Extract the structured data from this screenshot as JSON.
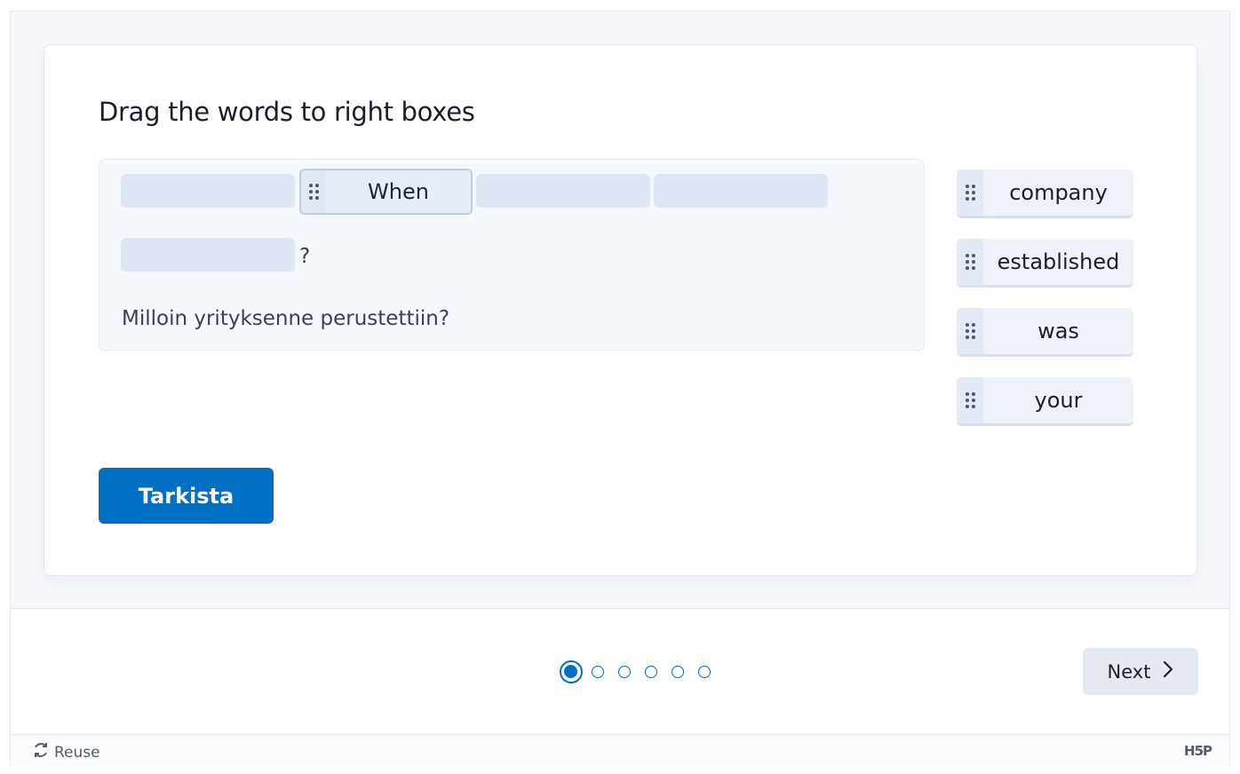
{
  "task": {
    "title": "Drag the words to right boxes",
    "placed_word": "When",
    "question_mark": "?",
    "translation": "Milloin yrityksenne perustettiin?",
    "word_bank": [
      "company",
      "established",
      "was",
      "your"
    ],
    "check_label": "Tarkista"
  },
  "navigation": {
    "total_slides": 6,
    "current_slide": 1,
    "next_label": "Next"
  },
  "footer": {
    "reuse_label": "Reuse",
    "logo_text": "H5P"
  },
  "colors": {
    "primary": "#0070c4",
    "dropzone": "#dfe7f5",
    "background": "#f6f8fc"
  },
  "icons": {
    "drag_handle": "drag-handle-icon",
    "next": "chevron-right-icon",
    "reuse": "reuse-icon"
  }
}
